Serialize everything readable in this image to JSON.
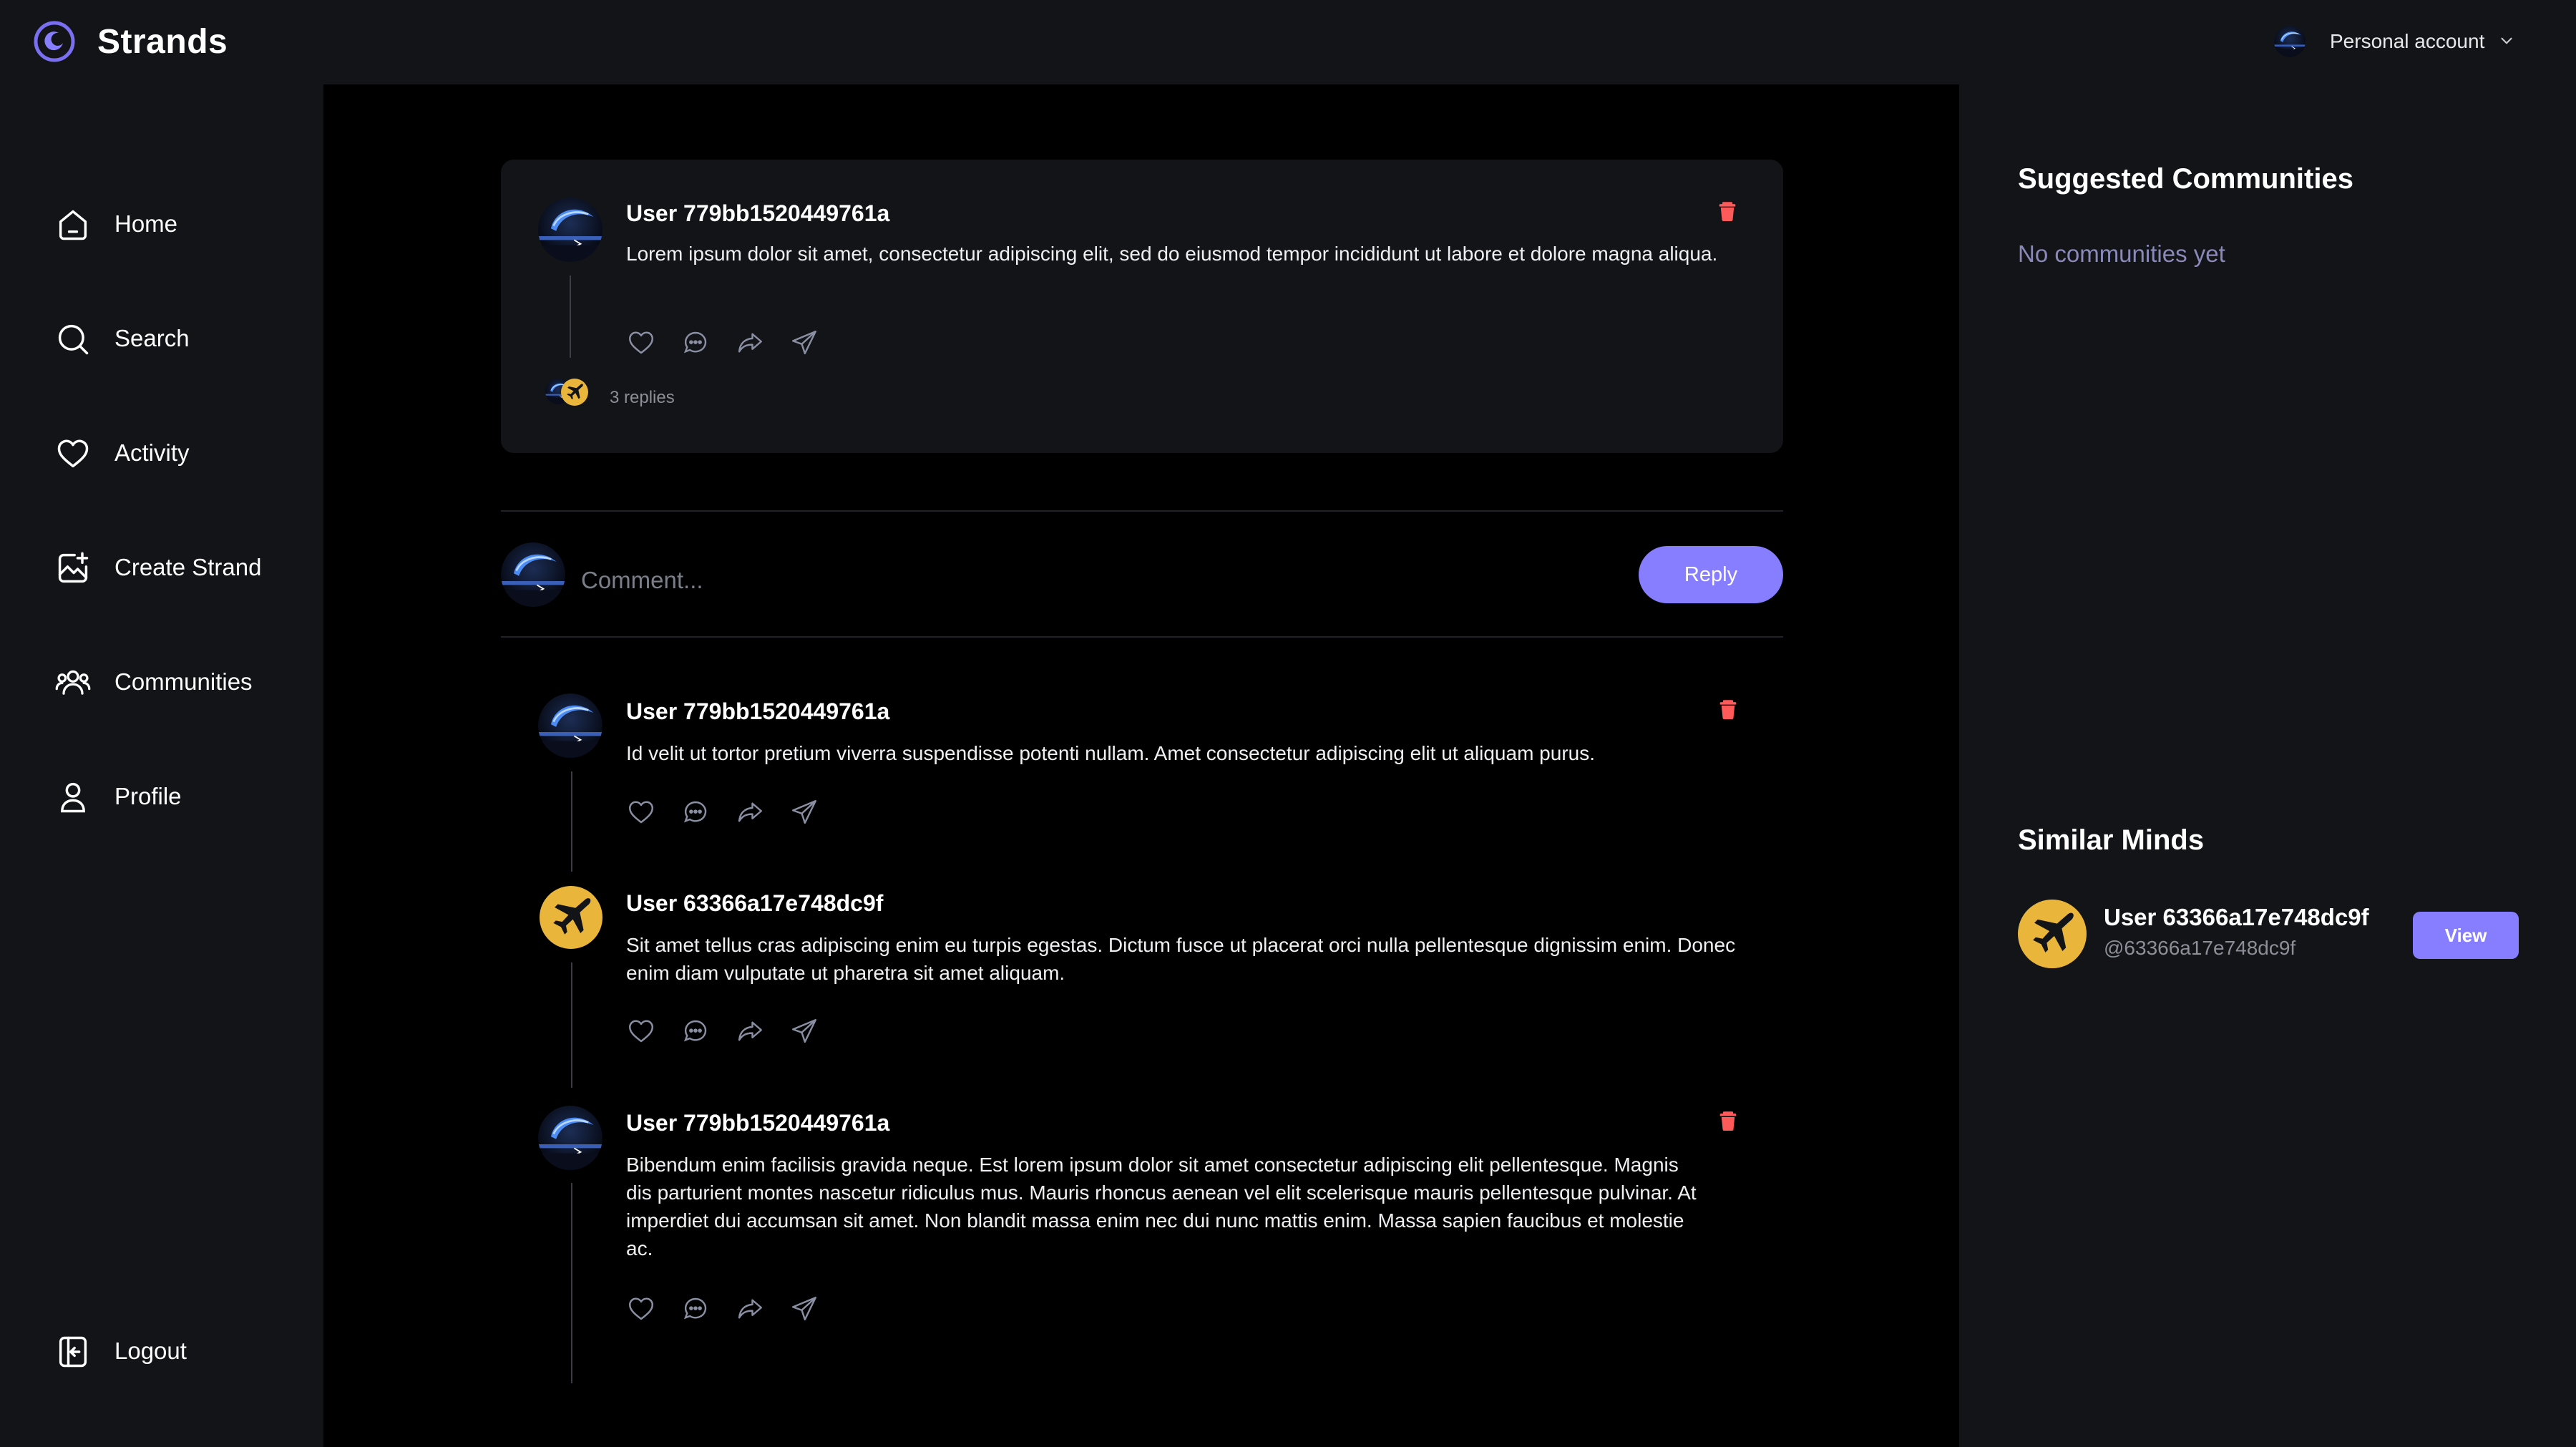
{
  "app": {
    "name": "Strands"
  },
  "account": {
    "label": "Personal account"
  },
  "nav": {
    "items": [
      {
        "label": "Home",
        "icon": "home-icon"
      },
      {
        "label": "Search",
        "icon": "search-icon"
      },
      {
        "label": "Activity",
        "icon": "heart-icon"
      },
      {
        "label": "Create Strand",
        "icon": "image-plus-icon"
      },
      {
        "label": "Communities",
        "icon": "users-icon"
      },
      {
        "label": "Profile",
        "icon": "user-icon"
      }
    ],
    "logout": "Logout"
  },
  "post": {
    "author": "User 779bb1520449761a",
    "text": "Lorem ipsum dolor sit amet, consectetur adipiscing elit, sed do eiusmod tempor incididunt ut labore et dolore magna aliqua.",
    "replies": "3 replies"
  },
  "composer": {
    "placeholder": "Comment...",
    "button": "Reply"
  },
  "replies": [
    {
      "author": "User 779bb1520449761a",
      "text": "Id velit ut tortor pretium viverra suspendisse potenti nullam. Amet consectetur adipiscing elit ut aliquam purus.",
      "deletable": true
    },
    {
      "author": "User 63366a17e748dc9f",
      "text": "Sit amet tellus cras adipiscing enim eu turpis egestas. Dictum fusce ut placerat orci nulla pellentesque dignissim enim. Donec enim diam vulputate ut pharetra sit amet aliquam.",
      "deletable": false
    },
    {
      "author": "User 779bb1520449761a",
      "text": "Bibendum enim facilisis gravida neque. Est lorem ipsum dolor sit amet consectetur adipiscing elit pellentesque. Magnis dis parturient montes nascetur ridiculus mus. Mauris rhoncus aenean vel elit scelerisque mauris pellentesque pulvinar. At imperdiet dui accumsan sit amet. Non blandit massa enim nec dui nunc mattis enim. Massa sapien faucibus et molestie ac.",
      "deletable": true
    }
  ],
  "suggested": {
    "title": "Suggested Communities",
    "empty": "No communities yet"
  },
  "similar": {
    "title": "Similar Minds",
    "user": {
      "name": "User 63366a17e748dc9f",
      "handle": "@63366a17e748dc9f",
      "button": "View"
    }
  },
  "colors": {
    "accent": "#877eff",
    "danger": "#ff5a5a",
    "avatar_gold": "#e9b53a",
    "muted_text": "#8a89b8"
  }
}
